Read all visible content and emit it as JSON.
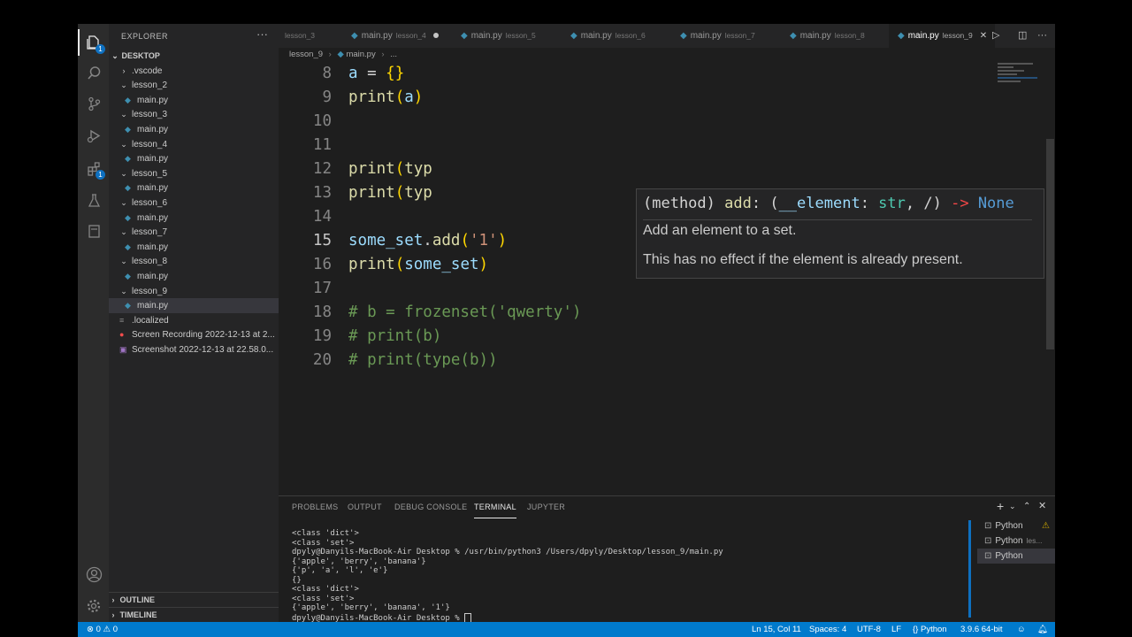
{
  "activity": {
    "explorer_badge": "1",
    "extensions_badge": "1"
  },
  "sidebar": {
    "title": "EXPLORER",
    "more": "···",
    "root": "DESKTOP",
    "items": [
      {
        "label": ".vscode",
        "type": "folder-closed",
        "indent": 1
      },
      {
        "label": "lesson_2",
        "type": "folder-open",
        "indent": 1
      },
      {
        "label": "main.py",
        "type": "py",
        "indent": 2
      },
      {
        "label": "lesson_3",
        "type": "folder-open",
        "indent": 1
      },
      {
        "label": "main.py",
        "type": "py",
        "indent": 2
      },
      {
        "label": "lesson_4",
        "type": "folder-open",
        "indent": 1
      },
      {
        "label": "main.py",
        "type": "py",
        "indent": 2
      },
      {
        "label": "lesson_5",
        "type": "folder-open",
        "indent": 1
      },
      {
        "label": "main.py",
        "type": "py",
        "indent": 2
      },
      {
        "label": "lesson_6",
        "type": "folder-open",
        "indent": 1
      },
      {
        "label": "main.py",
        "type": "py",
        "indent": 2
      },
      {
        "label": "lesson_7",
        "type": "folder-open",
        "indent": 1
      },
      {
        "label": "main.py",
        "type": "py",
        "indent": 2
      },
      {
        "label": "lesson_8",
        "type": "folder-open",
        "indent": 1
      },
      {
        "label": "main.py",
        "type": "py",
        "indent": 2
      },
      {
        "label": "lesson_9",
        "type": "folder-open",
        "indent": 1
      },
      {
        "label": "main.py",
        "type": "py",
        "indent": 2,
        "selected": true
      },
      {
        "label": ".localized",
        "type": "file",
        "indent": 1
      },
      {
        "label": "Screen Recording 2022-12-13 at 2...",
        "type": "recording",
        "indent": 1
      },
      {
        "label": "Screenshot 2022-12-13 at 22.58.0...",
        "type": "image",
        "indent": 1
      }
    ],
    "outline": "OUTLINE",
    "timeline": "TIMELINE"
  },
  "tabs": [
    {
      "label": "",
      "sub": "lesson_3"
    },
    {
      "label": "main.py",
      "sub": "lesson_4",
      "dirty": true
    },
    {
      "label": "main.py",
      "sub": "lesson_5"
    },
    {
      "label": "main.py",
      "sub": "lesson_6"
    },
    {
      "label": "main.py",
      "sub": "lesson_7"
    },
    {
      "label": "main.py",
      "sub": "lesson_8"
    },
    {
      "label": "main.py",
      "sub": "lesson_9",
      "active": true
    }
  ],
  "breadcrumb": {
    "folder": "lesson_9",
    "file": "main.py",
    "rest": "..."
  },
  "editor": {
    "current_line": 15,
    "lines": [
      {
        "n": "8",
        "html": "<span class='t-var'>a</span> = <span class='t-brk'>{}</span>"
      },
      {
        "n": "9",
        "html": "<span class='t-fn'>print</span><span class='t-brk'>(</span><span class='t-var'>a</span><span class='t-brk'>)</span>"
      },
      {
        "n": "10",
        "html": ""
      },
      {
        "n": "11",
        "html": ""
      },
      {
        "n": "12",
        "html": "<span class='t-fn'>print</span><span class='t-brk'>(</span><span class='t-fn'>typ</span>"
      },
      {
        "n": "13",
        "html": "<span class='t-fn'>print</span><span class='t-brk'>(</span><span class='t-fn'>typ</span>"
      },
      {
        "n": "14",
        "html": ""
      },
      {
        "n": "15",
        "html": "<span class='t-var'>some_set</span>.<span class='t-fn'>add</span><span class='t-brk'>(</span><span class='t-str'>'1'</span><span class='t-brk'>)</span>"
      },
      {
        "n": "16",
        "html": "<span class='t-fn'>print</span><span class='t-brk'>(</span><span class='t-var'>some_set</span><span class='t-brk'>)</span>"
      },
      {
        "n": "17",
        "html": ""
      },
      {
        "n": "18",
        "html": "<span class='t-cm'># b = frozenset('qwerty')</span>"
      },
      {
        "n": "19",
        "html": "<span class='t-cm'># print(b)</span>"
      },
      {
        "n": "20",
        "html": "<span class='t-cm'># print(type(b))</span>"
      }
    ]
  },
  "hover": {
    "signature_html": "(method) <span class='t-fn'>add</span>: (<span class='t-var'>__element</span>: <span style='color:#4ec9b0'>str</span>, /) <span style='color:#f44747'>-&gt;</span> <span style='color:#569cd6'>None</span>",
    "doc1": "Add an element to a set.",
    "doc2": "This has no effect if the element is already present."
  },
  "panel": {
    "tabs": [
      "PROBLEMS",
      "OUTPUT",
      "DEBUG CONSOLE",
      "TERMINAL",
      "JUPYTER"
    ],
    "active_tab": "TERMINAL",
    "terminal": [
      "<class 'dict'>",
      "<class 'set'>",
      "dpyly@Danyils-MacBook-Air Desktop % /usr/bin/python3 /Users/dpyly/Desktop/lesson_9/main.py",
      "{'apple', 'berry', 'banana'}",
      "{'p', 'a', 'l', 'e'}",
      "{}",
      "<class 'dict'>",
      "<class 'set'>",
      "{'apple', 'berry', 'banana', '1'}",
      "dpyly@Danyils-MacBook-Air Desktop % "
    ],
    "terminals": [
      {
        "label": "Python",
        "warn": true
      },
      {
        "label": "Python",
        "sub": "les..."
      },
      {
        "label": "Python",
        "selected": true
      }
    ]
  },
  "status": {
    "errors": "0",
    "warnings": "0",
    "position": "Ln 15, Col 11",
    "spaces": "Spaces: 4",
    "encoding": "UTF-8",
    "eol": "LF",
    "language": "Python",
    "interpreter": "3.9.6 64-bit"
  }
}
